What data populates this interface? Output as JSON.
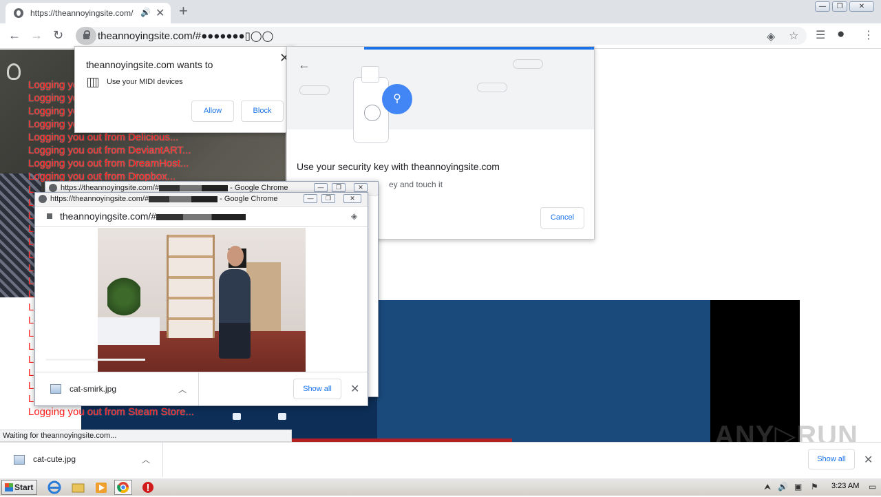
{
  "browser": {
    "tab": {
      "title": "https://theannoyingsite.com/#",
      "audio_icon": "speaker-icon",
      "close_glyph": "✕"
    },
    "new_tab_glyph": "+",
    "window_buttons": [
      "—",
      "❐",
      "✕"
    ],
    "nav": {
      "back": "←",
      "forward": "→",
      "reload": "↻"
    },
    "address": "theannoyingsite.com/#●●●●●●●▯◯◯",
    "toolbar_icons": [
      "eye-icon",
      "star-icon",
      "media-icon",
      "account-icon",
      "menu-icon"
    ]
  },
  "page": {
    "logout_lines": [
      "Logging you out from ...",
      "Logging you out from ...",
      "Logging you out from ...",
      "Logging you out from ...",
      "Logging you out from Delicious...",
      "Logging you out from DeviantART...",
      "Logging you out from DreamHost...",
      "Logging you out from Dropbox...",
      "L",
      "L",
      "L",
      "L",
      "L",
      "L",
      "L",
      "L",
      "L",
      "L",
      "L",
      "L",
      "L",
      "L",
      "L",
      "L",
      "Logging you out from Steam Community...",
      "Logging you out from Steam Store..."
    ]
  },
  "midi_prompt": {
    "title": "theannoyingsite.com wants to",
    "permission": "Use your MIDI devices",
    "allow_label": "Allow",
    "block_label": "Block",
    "close_glyph": "✕"
  },
  "security_key": {
    "back_glyph": "←",
    "title": "Use your security key with theannoyingsite.com",
    "subtitle": "ey and touch it",
    "cancel_label": "Cancel",
    "usb_glyph": "⚲"
  },
  "popup_back": {
    "title_prefix": "https://theannoyingsite.com/#",
    "title_suffix": "- Google Chrome"
  },
  "popup_front": {
    "title_prefix": "https://theannoyingsite.com/#",
    "title_suffix": "- Google Chrome",
    "url": "theannoyingsite.com/#",
    "download": {
      "file": "cat-smirk.jpg",
      "show_all": "Show all"
    }
  },
  "download_shelf": {
    "file": "cat-cute.jpg",
    "show_all": "Show all"
  },
  "status_text": "Waiting for theannoyingsite.com...",
  "watermark": "ANY▷RUN",
  "taskbar": {
    "start_label": "Start",
    "clock": "3:23 AM"
  }
}
